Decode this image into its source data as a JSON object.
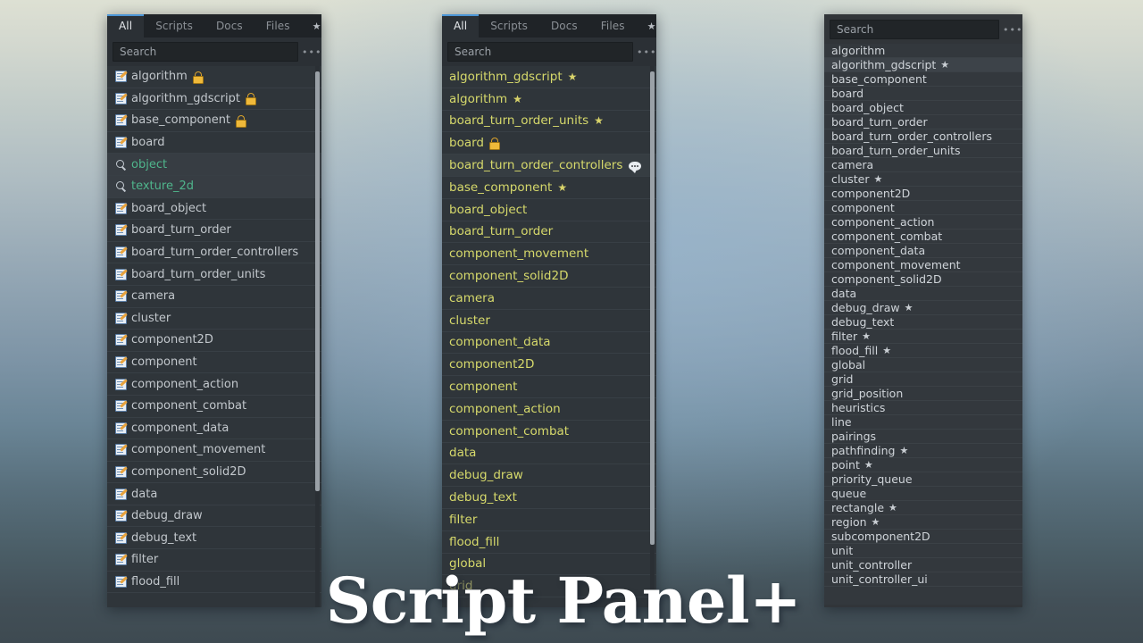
{
  "title_overlay": {
    "text": "Script Panel+"
  },
  "theme": {
    "accent": "#4b95d6",
    "panel_bg": "#2b3035",
    "list_bg": "#2f353a",
    "text_default": "#c2c7cc",
    "text_yellow": "#d6d96b",
    "text_resource_green": "#4fb58c",
    "star_yellow": "#d8d36a",
    "lock_gold": "#efb93a"
  },
  "panel1": {
    "tabs": [
      {
        "label": "All",
        "active": true
      },
      {
        "label": "Scripts",
        "active": false
      },
      {
        "label": "Docs",
        "active": false
      },
      {
        "label": "Files",
        "active": false
      },
      {
        "label": "★",
        "active": false
      }
    ],
    "search": {
      "placeholder": "Search",
      "value": ""
    },
    "more_label": "•••",
    "items": [
      {
        "label": "algorithm",
        "icon": "script-icon",
        "badge": "lock",
        "style": "default"
      },
      {
        "label": "algorithm_gdscript",
        "icon": "script-icon",
        "badge": "lock",
        "style": "default"
      },
      {
        "label": "base_component",
        "icon": "script-icon",
        "badge": "lock",
        "style": "default"
      },
      {
        "label": "board",
        "icon": "script-icon",
        "badge": "",
        "style": "default"
      },
      {
        "label": "object",
        "icon": "search-icon",
        "badge": "",
        "style": "resource"
      },
      {
        "label": "texture_2d",
        "icon": "search-icon",
        "badge": "",
        "style": "resource"
      },
      {
        "label": "board_object",
        "icon": "script-icon",
        "badge": "",
        "style": "default"
      },
      {
        "label": "board_turn_order",
        "icon": "script-icon",
        "badge": "",
        "style": "default"
      },
      {
        "label": "board_turn_order_controllers",
        "icon": "script-icon",
        "badge": "",
        "style": "default"
      },
      {
        "label": "board_turn_order_units",
        "icon": "script-icon",
        "badge": "",
        "style": "default"
      },
      {
        "label": "camera",
        "icon": "script-icon",
        "badge": "",
        "style": "default"
      },
      {
        "label": "cluster",
        "icon": "script-icon",
        "badge": "",
        "style": "default"
      },
      {
        "label": "component2D",
        "icon": "script-icon",
        "badge": "",
        "style": "default"
      },
      {
        "label": "component",
        "icon": "script-icon",
        "badge": "",
        "style": "default"
      },
      {
        "label": "component_action",
        "icon": "script-icon",
        "badge": "",
        "style": "default"
      },
      {
        "label": "component_combat",
        "icon": "script-icon",
        "badge": "",
        "style": "default"
      },
      {
        "label": "component_data",
        "icon": "script-icon",
        "badge": "",
        "style": "default"
      },
      {
        "label": "component_movement",
        "icon": "script-icon",
        "badge": "",
        "style": "default"
      },
      {
        "label": "component_solid2D",
        "icon": "script-icon",
        "badge": "",
        "style": "default"
      },
      {
        "label": "data",
        "icon": "script-icon",
        "badge": "",
        "style": "default"
      },
      {
        "label": "debug_draw",
        "icon": "script-icon",
        "badge": "",
        "style": "default"
      },
      {
        "label": "debug_text",
        "icon": "script-icon",
        "badge": "",
        "style": "default"
      },
      {
        "label": "filter",
        "icon": "script-icon",
        "badge": "",
        "style": "default"
      },
      {
        "label": "flood_fill",
        "icon": "script-icon",
        "badge": "",
        "style": "default"
      }
    ]
  },
  "panel2": {
    "tabs": [
      {
        "label": "All",
        "active": true
      },
      {
        "label": "Scripts",
        "active": false
      },
      {
        "label": "Docs",
        "active": false
      },
      {
        "label": "Files",
        "active": false
      },
      {
        "label": "★",
        "active": false
      }
    ],
    "search": {
      "placeholder": "Search",
      "value": ""
    },
    "more_label": "•••",
    "items": [
      {
        "label": "algorithm_gdscript",
        "badge": "star",
        "style": "default"
      },
      {
        "label": "algorithm",
        "badge": "star",
        "style": "default"
      },
      {
        "label": "board_turn_order_units",
        "badge": "star",
        "style": "default"
      },
      {
        "label": "board",
        "badge": "lock",
        "style": "default"
      },
      {
        "label": "board_turn_order_controllers",
        "badge": "bubble",
        "style": "highlighted"
      },
      {
        "label": "base_component",
        "badge": "star",
        "style": "default"
      },
      {
        "label": "board_object",
        "badge": "",
        "style": "default"
      },
      {
        "label": "board_turn_order",
        "badge": "",
        "style": "default"
      },
      {
        "label": "component_movement",
        "badge": "",
        "style": "default"
      },
      {
        "label": "component_solid2D",
        "badge": "",
        "style": "default"
      },
      {
        "label": "camera",
        "badge": "",
        "style": "default"
      },
      {
        "label": "cluster",
        "badge": "",
        "style": "default"
      },
      {
        "label": "component_data",
        "badge": "",
        "style": "default"
      },
      {
        "label": "component2D",
        "badge": "",
        "style": "default"
      },
      {
        "label": "component",
        "badge": "",
        "style": "default"
      },
      {
        "label": "component_action",
        "badge": "",
        "style": "default"
      },
      {
        "label": "component_combat",
        "badge": "",
        "style": "default"
      },
      {
        "label": "data",
        "badge": "",
        "style": "default"
      },
      {
        "label": "debug_draw",
        "badge": "",
        "style": "default"
      },
      {
        "label": "debug_text",
        "badge": "",
        "style": "default"
      },
      {
        "label": "filter",
        "badge": "",
        "style": "default"
      },
      {
        "label": "flood_fill",
        "badge": "",
        "style": "default"
      },
      {
        "label": "global",
        "badge": "",
        "style": "default"
      },
      {
        "label": "grid",
        "badge": "",
        "style": "dim"
      }
    ]
  },
  "panel3": {
    "search": {
      "placeholder": "Search",
      "value": ""
    },
    "more_label": "•••",
    "items": [
      {
        "label": "algorithm",
        "badge": "",
        "selected": false
      },
      {
        "label": "algorithm_gdscript",
        "badge": "star",
        "selected": true
      },
      {
        "label": "base_component",
        "badge": "",
        "selected": false
      },
      {
        "label": "board",
        "badge": "",
        "selected": false
      },
      {
        "label": "board_object",
        "badge": "",
        "selected": false
      },
      {
        "label": "board_turn_order",
        "badge": "",
        "selected": false
      },
      {
        "label": "board_turn_order_controllers",
        "badge": "",
        "selected": false
      },
      {
        "label": "board_turn_order_units",
        "badge": "",
        "selected": false
      },
      {
        "label": "camera",
        "badge": "",
        "selected": false
      },
      {
        "label": "cluster",
        "badge": "star",
        "selected": false
      },
      {
        "label": "component2D",
        "badge": "",
        "selected": false
      },
      {
        "label": "component",
        "badge": "",
        "selected": false
      },
      {
        "label": "component_action",
        "badge": "",
        "selected": false
      },
      {
        "label": "component_combat",
        "badge": "",
        "selected": false
      },
      {
        "label": "component_data",
        "badge": "",
        "selected": false
      },
      {
        "label": "component_movement",
        "badge": "",
        "selected": false
      },
      {
        "label": "component_solid2D",
        "badge": "",
        "selected": false
      },
      {
        "label": "data",
        "badge": "",
        "selected": false
      },
      {
        "label": "debug_draw",
        "badge": "star",
        "selected": false
      },
      {
        "label": "debug_text",
        "badge": "",
        "selected": false
      },
      {
        "label": "filter",
        "badge": "star",
        "selected": false
      },
      {
        "label": "flood_fill",
        "badge": "star",
        "selected": false
      },
      {
        "label": "global",
        "badge": "",
        "selected": false
      },
      {
        "label": "grid",
        "badge": "",
        "selected": false
      },
      {
        "label": "grid_position",
        "badge": "",
        "selected": false
      },
      {
        "label": "heuristics",
        "badge": "",
        "selected": false
      },
      {
        "label": "line",
        "badge": "",
        "selected": false
      },
      {
        "label": "pairings",
        "badge": "",
        "selected": false
      },
      {
        "label": "pathfinding",
        "badge": "star",
        "selected": false
      },
      {
        "label": "point",
        "badge": "star",
        "selected": false
      },
      {
        "label": "priority_queue",
        "badge": "",
        "selected": false
      },
      {
        "label": "queue",
        "badge": "",
        "selected": false
      },
      {
        "label": "rectangle",
        "badge": "star",
        "selected": false
      },
      {
        "label": "region",
        "badge": "star",
        "selected": false
      },
      {
        "label": "subcomponent2D",
        "badge": "",
        "selected": false
      },
      {
        "label": "unit",
        "badge": "",
        "selected": false
      },
      {
        "label": "unit_controller",
        "badge": "",
        "selected": false
      },
      {
        "label": "unit_controller_ui",
        "badge": "",
        "selected": false
      }
    ]
  }
}
